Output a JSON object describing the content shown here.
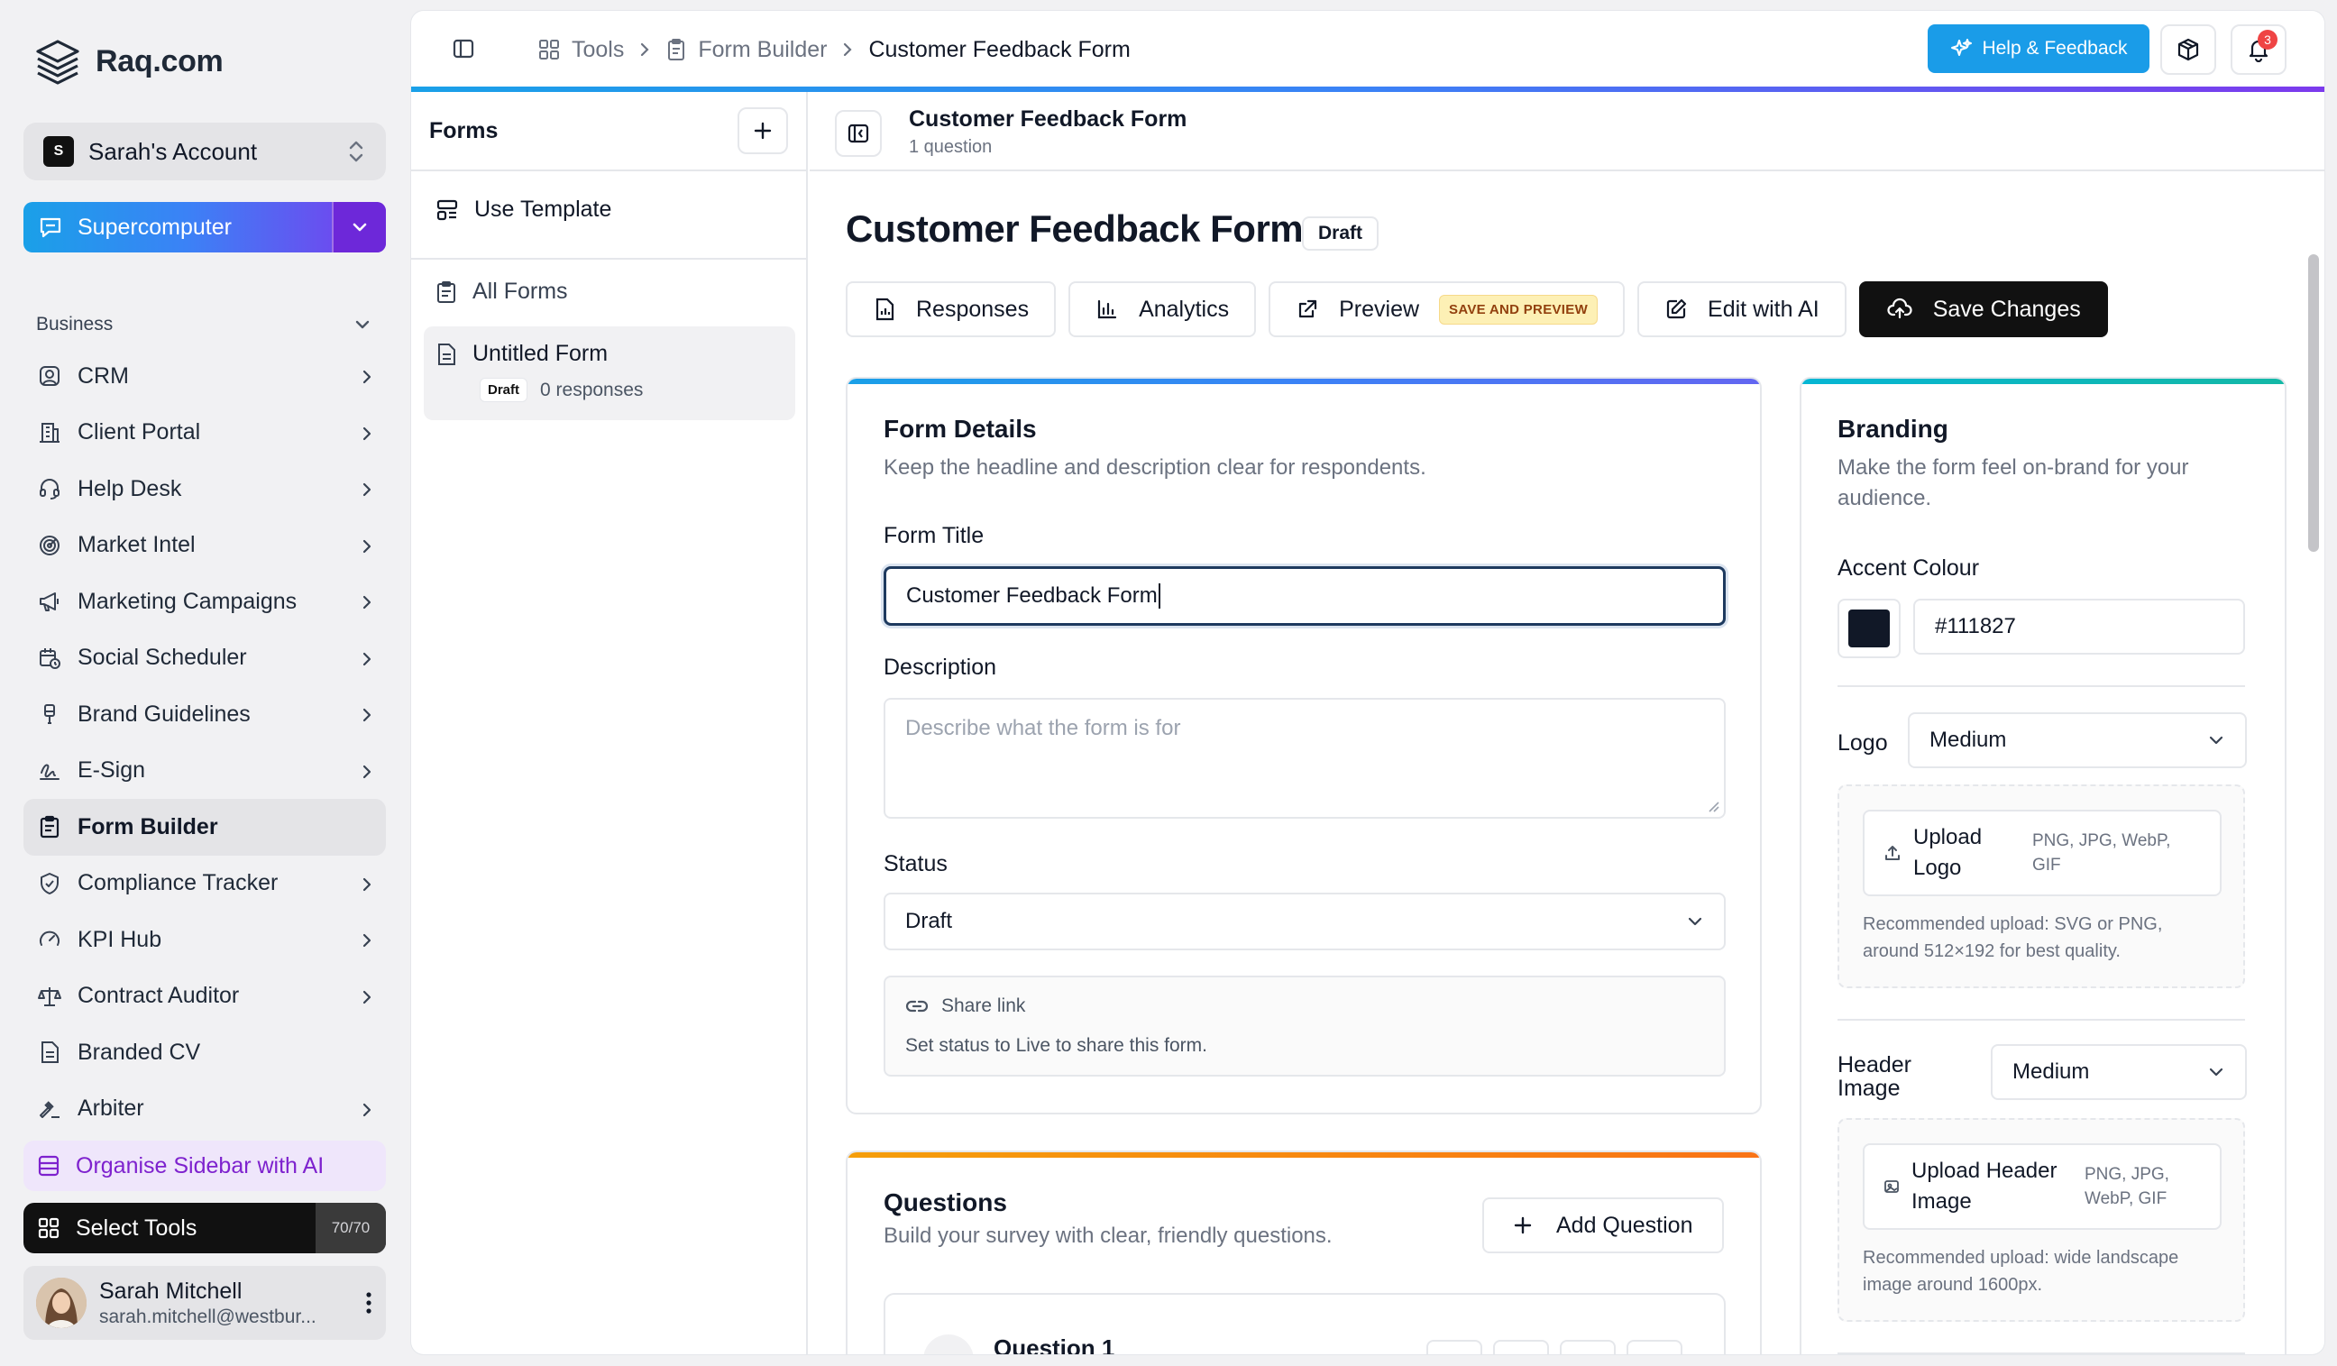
{
  "app": {
    "name": "Raq.com"
  },
  "account": {
    "initial": "S",
    "name": "Sarah's Account"
  },
  "supercomputer": {
    "label": "Supercomputer"
  },
  "sidebar": {
    "section": "Business",
    "items": [
      {
        "label": "CRM",
        "icon": "user-circle-icon",
        "chevron": true
      },
      {
        "label": "Client Portal",
        "icon": "building-icon",
        "chevron": true
      },
      {
        "label": "Help Desk",
        "icon": "headset-icon",
        "chevron": true
      },
      {
        "label": "Market Intel",
        "icon": "radar-icon",
        "chevron": true
      },
      {
        "label": "Marketing Campaigns",
        "icon": "megaphone-icon",
        "chevron": true
      },
      {
        "label": "Social Scheduler",
        "icon": "calendar-clock-icon",
        "chevron": true
      },
      {
        "label": "Brand Guidelines",
        "icon": "brush-icon",
        "chevron": true
      },
      {
        "label": "E-Sign",
        "icon": "signature-icon",
        "chevron": true
      },
      {
        "label": "Form Builder",
        "icon": "clipboard-icon",
        "chevron": false,
        "active": true
      },
      {
        "label": "Compliance Tracker",
        "icon": "shield-check-icon",
        "chevron": true
      },
      {
        "label": "KPI Hub",
        "icon": "gauge-icon",
        "chevron": true
      },
      {
        "label": "Contract Auditor",
        "icon": "scale-icon",
        "chevron": true
      },
      {
        "label": "Branded CV",
        "icon": "document-icon",
        "chevron": false
      },
      {
        "label": "Arbiter",
        "icon": "gavel-icon",
        "chevron": true
      }
    ],
    "organise": "Organise Sidebar with AI",
    "select_tools": "Select Tools",
    "select_count": "70/70"
  },
  "user": {
    "name": "Sarah Mitchell",
    "email": "sarah.mitchell@westbur..."
  },
  "topbar": {
    "crumbs": [
      "Tools",
      "Form Builder",
      "Customer Feedback Form"
    ],
    "help": "Help & Feedback",
    "notifications": "3"
  },
  "forms": {
    "title": "Forms",
    "use_template": "Use Template",
    "all_forms": "All Forms",
    "untitled": {
      "title": "Untitled Form",
      "status": "Draft",
      "responses": "0 responses"
    }
  },
  "editor": {
    "head_title": "Customer Feedback Form",
    "head_sub": "1 question",
    "title": "Customer Feedback Form",
    "status_badge": "Draft",
    "actions": {
      "responses": "Responses",
      "analytics": "Analytics",
      "preview": "Preview",
      "preview_tag": "SAVE AND PREVIEW",
      "edit_ai": "Edit with AI",
      "save": "Save Changes"
    }
  },
  "details": {
    "title": "Form Details",
    "desc": "Keep the headline and description clear for respondents.",
    "form_title_label": "Form Title",
    "form_title_value": "Customer Feedback Form",
    "description_label": "Description",
    "description_placeholder": "Describe what the form is for",
    "status_label": "Status",
    "status_value": "Draft",
    "share_title": "Share link",
    "share_desc": "Set status to Live to share this form."
  },
  "questions": {
    "title": "Questions",
    "desc": "Build your survey with clear, friendly questions.",
    "add": "Add Question",
    "q1": "Question 1"
  },
  "branding": {
    "title": "Branding",
    "desc": "Make the form feel on-brand for your audience.",
    "accent_label": "Accent Colour",
    "accent_value": "#111827",
    "accent_color": "#111827",
    "logo_label": "Logo",
    "logo_size": "Medium",
    "upload_logo": "Upload Logo",
    "logo_formats": "PNG, JPG, WebP, GIF",
    "logo_hint": "Recommended upload: SVG or PNG, around 512×192 for best quality.",
    "header_label": "Header Image",
    "header_size": "Medium",
    "upload_header": "Upload Header Image",
    "header_formats": "PNG, JPG, WebP, GIF",
    "header_hint": "Recommended upload: wide landscape image around 1600px."
  },
  "colors": {
    "accent_blue": "#1a9ce8",
    "accent_purple": "#7c3aed",
    "questions_bar": "#f59e0b",
    "branding_bar": "#14b8a6"
  }
}
